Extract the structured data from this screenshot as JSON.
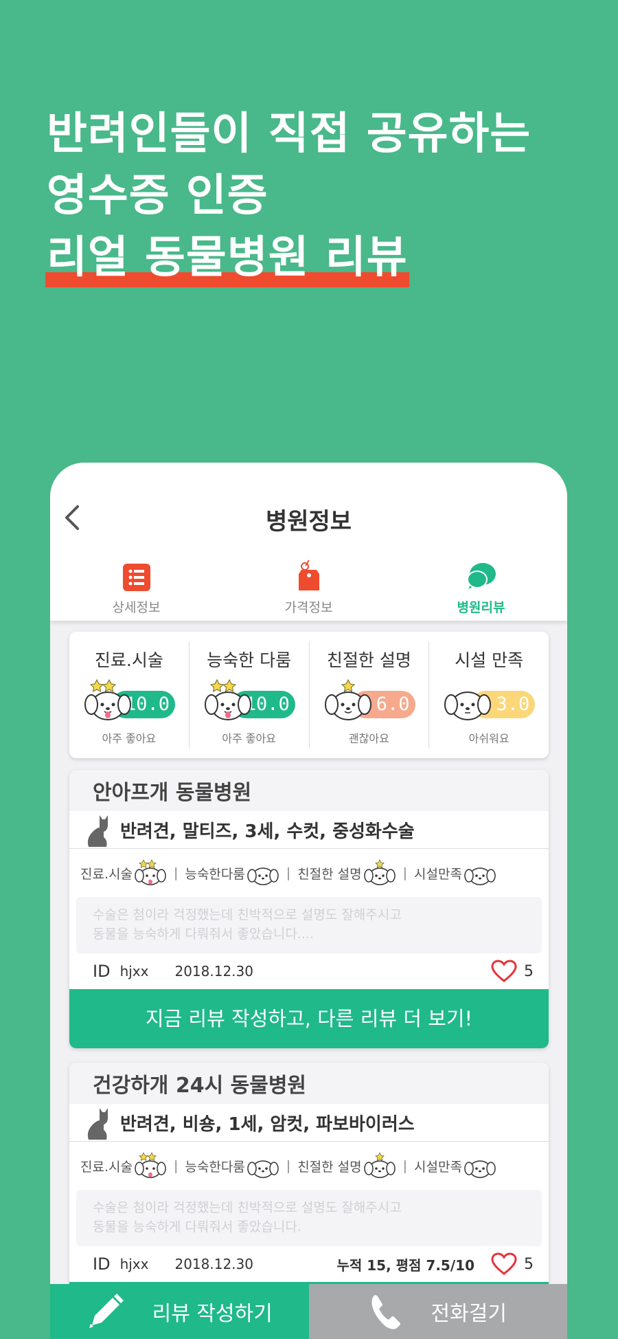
{
  "headline": {
    "line1": "반려인들이 직접 공유하는",
    "line2": "영수증 인증",
    "line3": "리얼 동물병원 리뷰"
  },
  "header": {
    "title": "병원정보"
  },
  "tabs": [
    {
      "label": "상세정보",
      "icon": "list-icon"
    },
    {
      "label": "가격정보",
      "icon": "price-tag-icon"
    },
    {
      "label": "병원리뷰",
      "icon": "chat-bubble-icon",
      "active": true
    }
  ],
  "ratings": [
    {
      "title": "진료.시술",
      "score": "10.0",
      "desc": "아주 좋아요",
      "stars": 2,
      "color": "#1fb98a"
    },
    {
      "title": "능숙한 다룸",
      "score": "10.0",
      "desc": "아주 좋아요",
      "stars": 2,
      "color": "#1fb98a"
    },
    {
      "title": "친절한 설명",
      "score": "6.0",
      "desc": "괜찮아요",
      "stars": 1,
      "color": "#f6a98c"
    },
    {
      "title": "시설 만족",
      "score": "3.0",
      "desc": "아쉬워요",
      "stars": 0,
      "color": "#fbd77a"
    }
  ],
  "reviews": [
    {
      "hospital": "안아프개 동물병원",
      "pet": "반려견, 말티즈, 3세, 수컷, 중성화수술",
      "mini": [
        "진료.시술",
        "능숙한다룸",
        "친절한 설명",
        "시설만족"
      ],
      "text_line1": "수술은 첨이라 걱정했는데 친박적으로 설명도 잘해주시고",
      "text_line2": "동물을 능숙하게 다뤄줘서 좋았습니다....",
      "id_label": "ID",
      "user": "hjxx",
      "date": "2018.12.30",
      "likes": "5",
      "cta": "지금 리뷰 작성하고, 다른 리뷰 더 보기!"
    },
    {
      "hospital": "건강하개 24시 동물병원",
      "pet": "반려견, 비숑, 1세, 암컷, 파보바이러스",
      "mini": [
        "진료.시술",
        "능숙한다룸",
        "친절한 설명",
        "시설만족"
      ],
      "text_line1": "수술은 첨이라 걱정했는데 친박적으로 설명도 잘해주시고",
      "text_line2": "동물을 능숙하게 다뤄줘서 좋았습니다.",
      "id_label": "ID",
      "user": "hjxx",
      "date": "2018.12.30",
      "stats": "누적 15, 평점 7.5/10",
      "likes": "5"
    }
  ],
  "bottom_bar": {
    "write_label": "리뷰 작성하기",
    "call_label": "전화걸기"
  }
}
